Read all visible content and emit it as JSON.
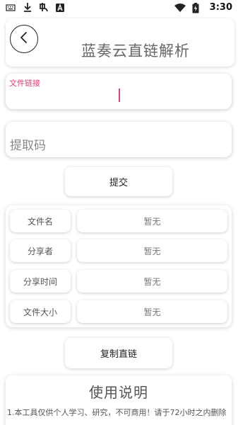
{
  "status_bar": {
    "time": "3:30",
    "icons": [
      "keyboard-icon",
      "download-icon",
      "app-icon",
      "a-box-icon",
      "wifi-icon",
      "battery-charging-icon"
    ]
  },
  "header": {
    "title": "蓝奏云直链解析",
    "back_icon": "chevron-left-icon"
  },
  "link_field": {
    "label": "文件链接",
    "value": ""
  },
  "code_field": {
    "placeholder": "提取码",
    "value": ""
  },
  "buttons": {
    "submit_label": "提交",
    "copy_label": "复制直链"
  },
  "info": {
    "rows": [
      {
        "key": "文件名",
        "value": "暂无"
      },
      {
        "key": "分享者",
        "value": "暂无"
      },
      {
        "key": "分享时间",
        "value": "暂无"
      },
      {
        "key": "文件大小",
        "value": "暂无"
      }
    ]
  },
  "usage": {
    "title": "使用说明",
    "text": "1.本工具仅供个人学习、研究，不可商用！请于72小时之内删除"
  },
  "colors": {
    "accent": "#e0407a",
    "text": "#333333",
    "muted": "#888888"
  }
}
